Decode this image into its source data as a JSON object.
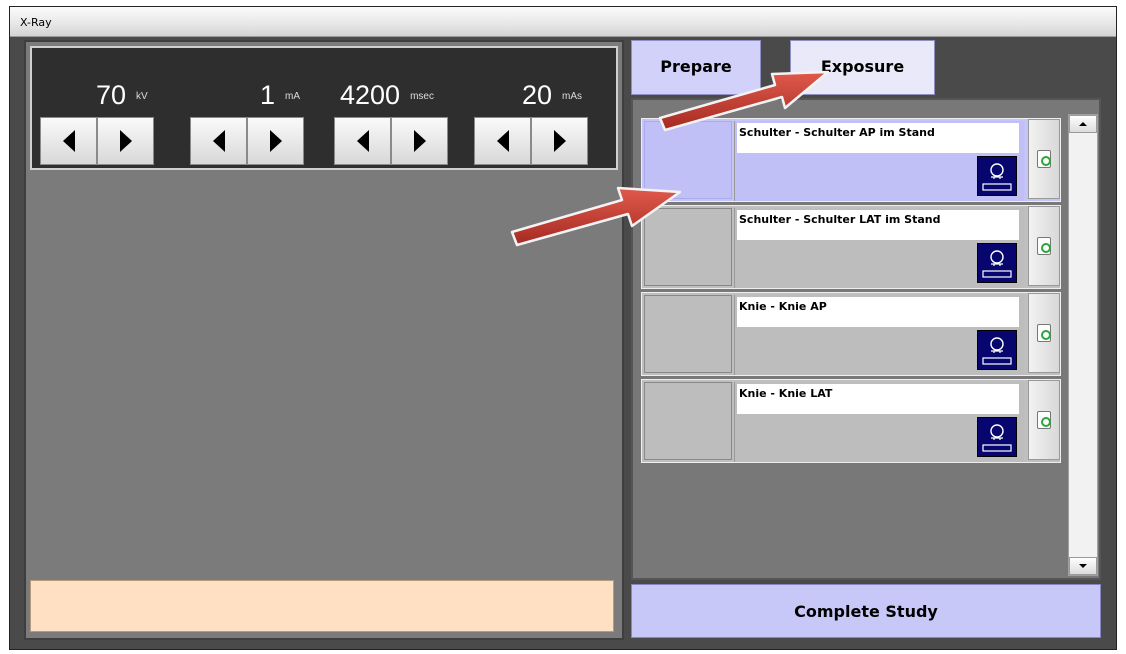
{
  "window": {
    "title": "X-Ray"
  },
  "parameters": [
    {
      "value": "70",
      "unit": "kV"
    },
    {
      "value": "1",
      "unit": "mA"
    },
    {
      "value": "4200",
      "unit": "msec"
    },
    {
      "value": "20",
      "unit": "mAs"
    }
  ],
  "tabs": {
    "prepare": "Prepare",
    "exposure": "Exposure"
  },
  "studies": [
    {
      "name": "Schulter - Schulter AP im Stand",
      "active": true
    },
    {
      "name": "Schulter - Schulter LAT im Stand",
      "active": false
    },
    {
      "name": "Knie - Knie AP",
      "active": false
    },
    {
      "name": "Knie - Knie LAT",
      "active": false
    }
  ],
  "actions": {
    "complete_study": "Complete Study"
  },
  "colors": {
    "tab_fill": "#d1d1fa",
    "active_row": "#c4c4f8",
    "status_box": "#ffe0c2",
    "position_icon": "#06066e",
    "annotation_arrow": "#c0392b"
  },
  "icons": {
    "decrement": "left-triangle-icon",
    "increment": "right-triangle-icon",
    "position": "patient-position-icon",
    "delete": "recycle-bin-icon"
  }
}
